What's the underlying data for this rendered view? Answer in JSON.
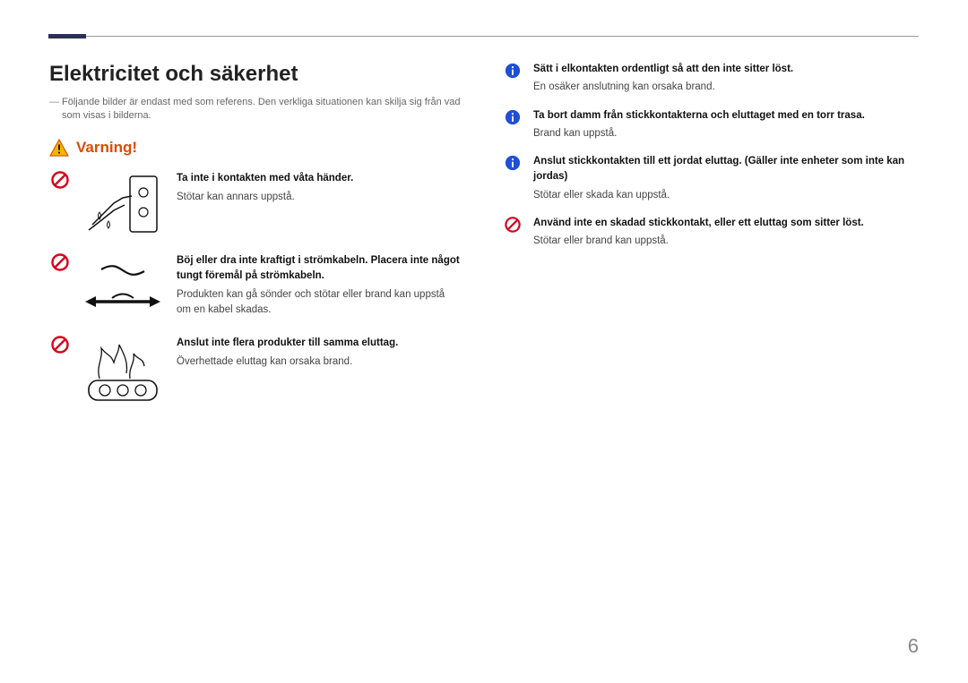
{
  "title": "Elektricitet och säkerhet",
  "note": "Följande bilder är endast med som referens. Den verkliga situationen kan skilja sig från vad som visas i bilderna.",
  "warning_label": "Varning!",
  "left_items": [
    {
      "bold": "Ta inte i kontakten med våta händer.",
      "body": "Stötar kan annars uppstå."
    },
    {
      "bold": "Böj eller dra inte kraftigt i strömkabeln. Placera inte något tungt föremål på strömkabeln.",
      "body": "Produkten kan gå sönder och stötar eller brand kan uppstå om en kabel skadas."
    },
    {
      "bold": "Anslut inte flera produkter till samma eluttag.",
      "body": "Överhettade eluttag kan orsaka brand."
    }
  ],
  "right_items": [
    {
      "icon": "info",
      "bold": "Sätt i elkontakten ordentligt så att den inte sitter löst.",
      "body": "En osäker anslutning kan orsaka brand."
    },
    {
      "icon": "info",
      "bold": "Ta bort damm från stickkontakterna och eluttaget med en torr trasa.",
      "body": "Brand kan uppstå."
    },
    {
      "icon": "info",
      "bold": "Anslut stickkontakten till ett jordat eluttag. (Gäller inte enheter som inte kan jordas)",
      "body": "Stötar eller skada kan uppstå."
    },
    {
      "icon": "prohibit",
      "bold": "Använd inte en skadad stickkontakt, eller ett eluttag som sitter löst.",
      "body": "Stötar eller brand kan uppstå."
    }
  ],
  "page_number": "6"
}
